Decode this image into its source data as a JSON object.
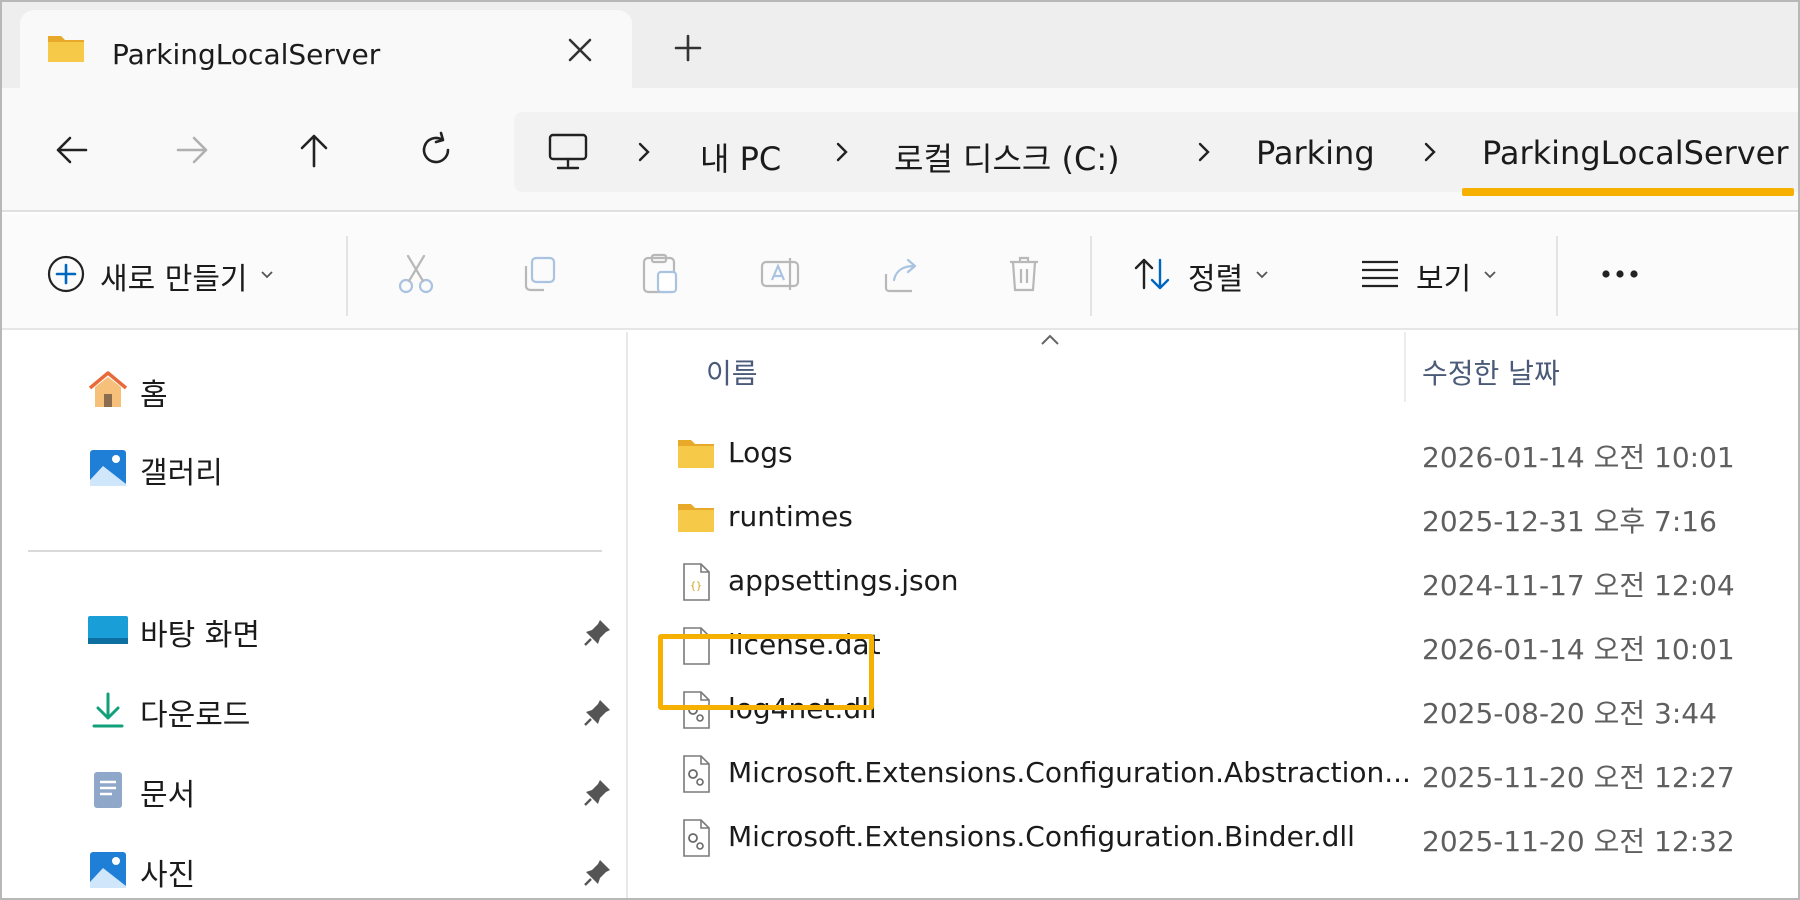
{
  "window": {
    "tab_title": "ParkingLocalServer",
    "new_tab_symbol": "+"
  },
  "breadcrumb": {
    "items": [
      "내 PC",
      "로컬 디스크 (C:)",
      "Parking",
      "ParkingLocalServer"
    ]
  },
  "commandbar": {
    "new_label": "새로 만들기",
    "sort_label": "정렬",
    "view_label": "보기",
    "more_symbol": "•••"
  },
  "sidebar": {
    "items": [
      {
        "label": "홈",
        "icon": "home-icon"
      },
      {
        "label": "갤러리",
        "icon": "gallery-icon"
      },
      {
        "label": "바탕 화면",
        "icon": "desktop-icon",
        "pinned": true
      },
      {
        "label": "다운로드",
        "icon": "download-icon",
        "pinned": true
      },
      {
        "label": "문서",
        "icon": "document-icon",
        "pinned": true
      },
      {
        "label": "사진",
        "icon": "pictures-icon",
        "pinned": true
      }
    ]
  },
  "filelist": {
    "col_name": "이름",
    "col_date": "수정한 날짜",
    "rows": [
      {
        "name": "Logs",
        "date": "2026-01-14 오전 10:01",
        "type": "folder"
      },
      {
        "name": "runtimes",
        "date": "2025-12-31 오후 7:16",
        "type": "folder"
      },
      {
        "name": "appsettings.json",
        "date": "2024-11-17 오전 12:04",
        "type": "json"
      },
      {
        "name": "license.dat",
        "date": "2026-01-14 오전 10:01",
        "type": "file",
        "highlighted": true
      },
      {
        "name": "log4net.dll",
        "date": "2025-08-20 오전 3:44",
        "type": "dll"
      },
      {
        "name": "Microsoft.Extensions.Configuration.Abstraction...",
        "date": "2025-11-20 오전 12:27",
        "type": "dll"
      },
      {
        "name": "Microsoft.Extensions.Configuration.Binder.dll",
        "date": "2025-11-20 오전 12:32",
        "type": "dll"
      }
    ]
  },
  "colors": {
    "accent": "#f5b000",
    "folder": "#f7c948",
    "link_blue": "#0067c0"
  }
}
